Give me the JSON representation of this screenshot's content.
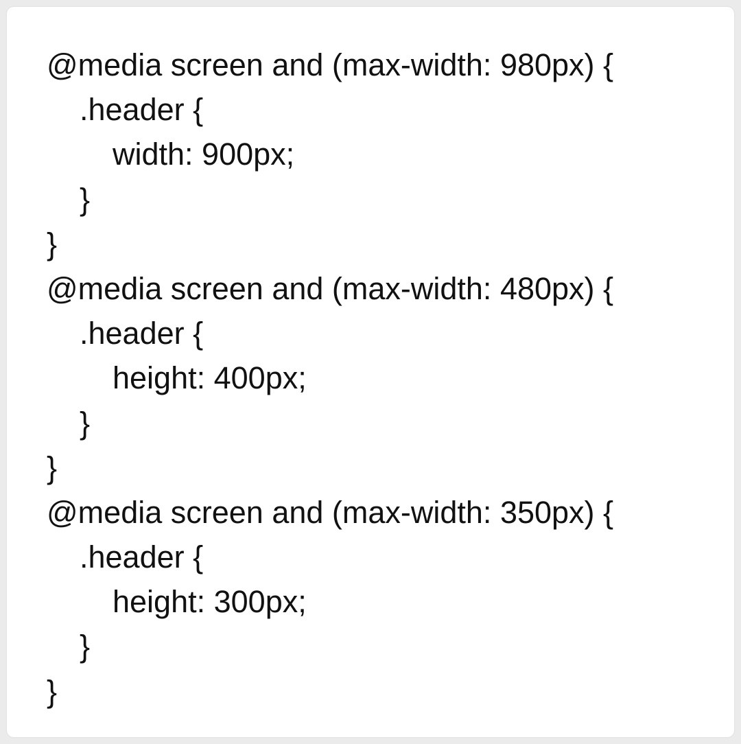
{
  "code": {
    "lines": [
      "@media screen and (max-width: 980px) {",
      ".header {",
      "width: 900px;",
      "}",
      "}",
      "@media screen and (max-width: 480px) {",
      ".header {",
      "height: 400px;",
      "}",
      "}",
      "@media screen and (max-width: 350px) {",
      ".header {",
      "height: 300px;",
      "}",
      "}"
    ]
  }
}
